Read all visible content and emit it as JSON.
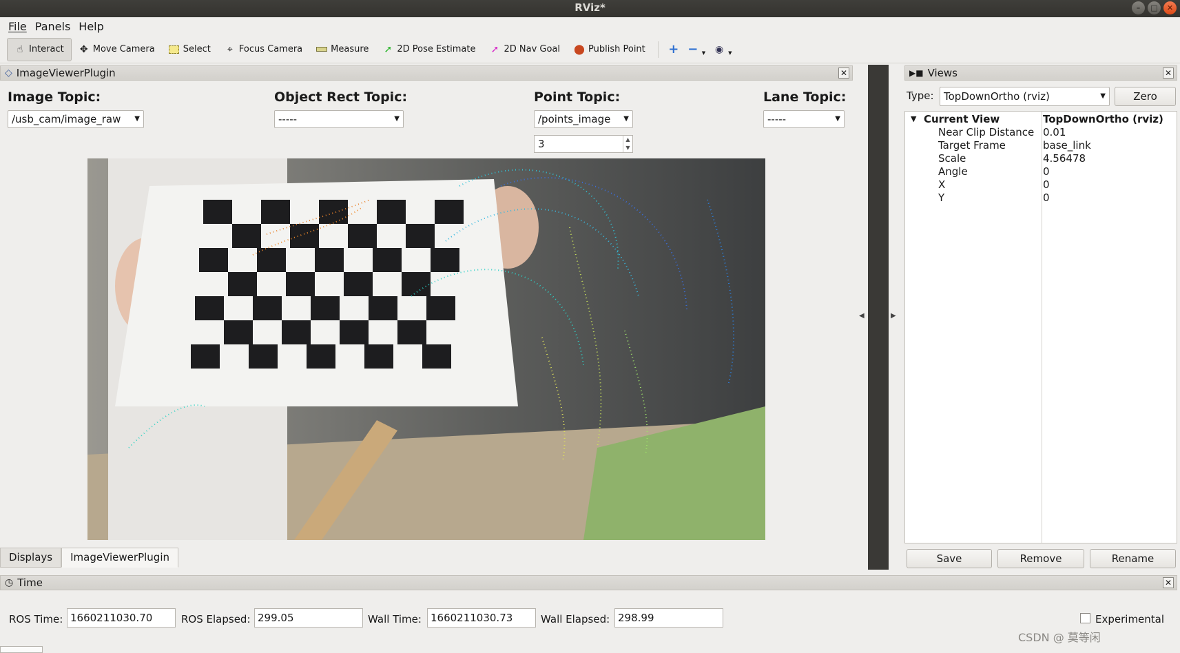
{
  "window": {
    "title": "RViz*"
  },
  "menu": {
    "file": "File",
    "panels": "Panels",
    "help": "Help"
  },
  "toolbar": {
    "interact": "Interact",
    "move_camera": "Move Camera",
    "select": "Select",
    "focus_camera": "Focus Camera",
    "measure": "Measure",
    "pose_estimate": "2D Pose Estimate",
    "nav_goal": "2D Nav Goal",
    "publish_point": "Publish Point"
  },
  "image_panel": {
    "title": "ImageViewerPlugin",
    "image_topic_label": "Image Topic:",
    "image_topic_value": "/usb_cam/image_raw",
    "object_rect_label": "Object Rect Topic:",
    "object_rect_value": "-----",
    "point_topic_label": "Point Topic:",
    "point_topic_value": "/points_image",
    "point_size_value": "3",
    "lane_topic_label": "Lane Topic:",
    "lane_topic_value": "-----"
  },
  "tabs": {
    "displays": "Displays",
    "image_viewer": "ImageViewerPlugin"
  },
  "views_panel": {
    "title": "Views",
    "type_label": "Type:",
    "type_value": "TopDownOrtho (rviz)",
    "zero_button": "Zero",
    "current_view": {
      "key": "Current View",
      "value": "TopDownOrtho (rviz)"
    },
    "properties": [
      {
        "key": "Near Clip Distance",
        "value": "0.01"
      },
      {
        "key": "Target Frame",
        "value": "base_link"
      },
      {
        "key": "Scale",
        "value": "4.56478"
      },
      {
        "key": "Angle",
        "value": "0"
      },
      {
        "key": "X",
        "value": "0"
      },
      {
        "key": "Y",
        "value": "0"
      }
    ],
    "save_button": "Save",
    "remove_button": "Remove",
    "rename_button": "Rename"
  },
  "time_panel": {
    "title": "Time",
    "ros_time_label": "ROS Time:",
    "ros_time_value": "1660211030.70",
    "ros_elapsed_label": "ROS Elapsed:",
    "ros_elapsed_value": "299.05",
    "wall_time_label": "Wall Time:",
    "wall_time_value": "1660211030.73",
    "wall_elapsed_label": "Wall Elapsed:",
    "wall_elapsed_value": "298.99",
    "experimental_label": "Experimental"
  },
  "watermark": "CSDN @ 莫等闲"
}
